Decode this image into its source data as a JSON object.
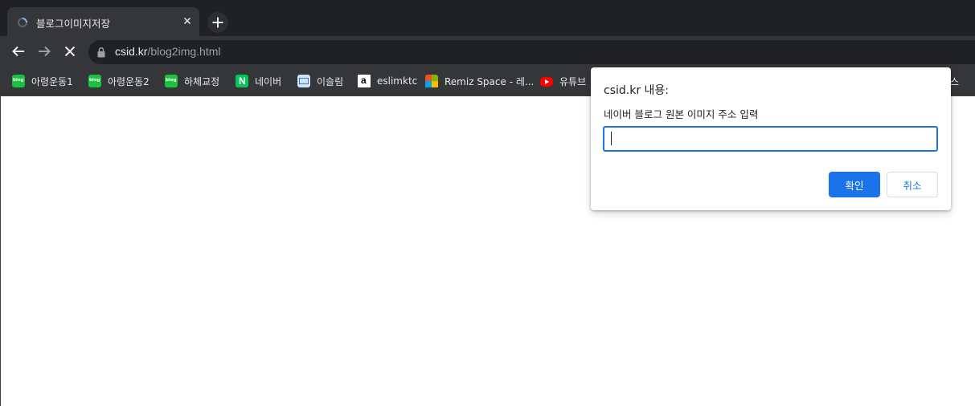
{
  "tab": {
    "title": "블로그이미지저장",
    "favicon": "loading-favicon-icon"
  },
  "toolbar": {
    "url_host": "csid.kr",
    "url_path": "/blog2img.html",
    "icons": [
      "back-arrow-icon",
      "forward-arrow-icon",
      "stop-loading-icon",
      "lock-icon"
    ]
  },
  "bookmarks": [
    {
      "label": "아령운동1",
      "icon": "naver-blog-icon"
    },
    {
      "label": "아령운동2",
      "icon": "naver-blog-icon"
    },
    {
      "label": "하체교정",
      "icon": "naver-blog-icon"
    },
    {
      "label": "네이버",
      "icon": "naver-icon"
    },
    {
      "label": "이슬림",
      "icon": "mail-icon"
    },
    {
      "label": "eslimktc",
      "icon": "a-logo-icon"
    },
    {
      "label": "Remiz Space - 레...",
      "icon": "microsoft-icon"
    },
    {
      "label": "유튜브",
      "icon": "youtube-icon"
    }
  ],
  "bookmarks_overflow_text": "스",
  "dialog": {
    "title": "csid.kr 내용:",
    "message": "네이버 블로그 원본 이미지 주소 입력",
    "input_value": "",
    "ok_label": "확인",
    "cancel_label": "취소"
  },
  "colors": {
    "accent": "#1a73e8",
    "chrome_dark": "#202124",
    "toolbar": "#35363a"
  }
}
